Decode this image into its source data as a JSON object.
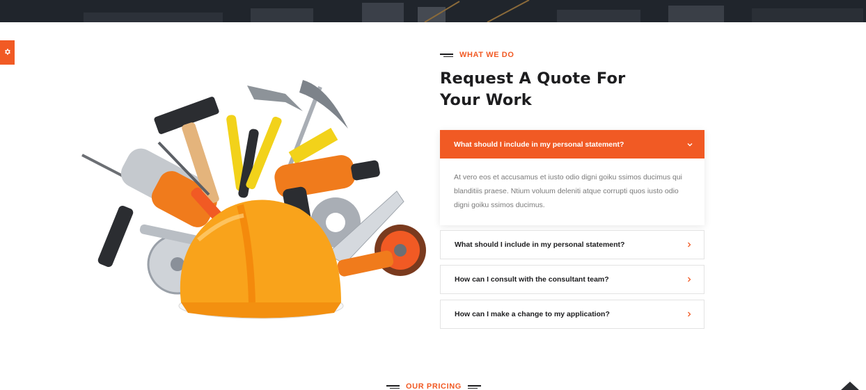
{
  "colors": {
    "accent": "#f15a24",
    "heading": "#1d1d1f",
    "body_text": "#7a7a7a",
    "border": "#e3e3e3"
  },
  "icons": {
    "settings": "gear-icon",
    "chevron_open": "chevron-down-icon",
    "chevron_closed": "chevron-right-icon",
    "scroll_top": "caret-up-icon"
  },
  "section": {
    "eyebrow": "WHAT WE DO",
    "title_line1": "Request A Quote For",
    "title_line2": "Your Work"
  },
  "faq": [
    {
      "question": "What should I include in my personal statement?",
      "answer": "At vero eos et accusamus et iusto odio digni goiku ssimos ducimus qui blanditiis praese. Ntium voluum deleniti atque corrupti quos iusto odio digni goiku ssimos ducimus.",
      "open": true
    },
    {
      "question": "What should I include in my personal statement?",
      "open": false
    },
    {
      "question": "How can I consult with the consultant team?",
      "open": false
    },
    {
      "question": "How can I make a change to my application?",
      "open": false
    }
  ],
  "pricing": {
    "eyebrow": "OUR PRICING"
  }
}
